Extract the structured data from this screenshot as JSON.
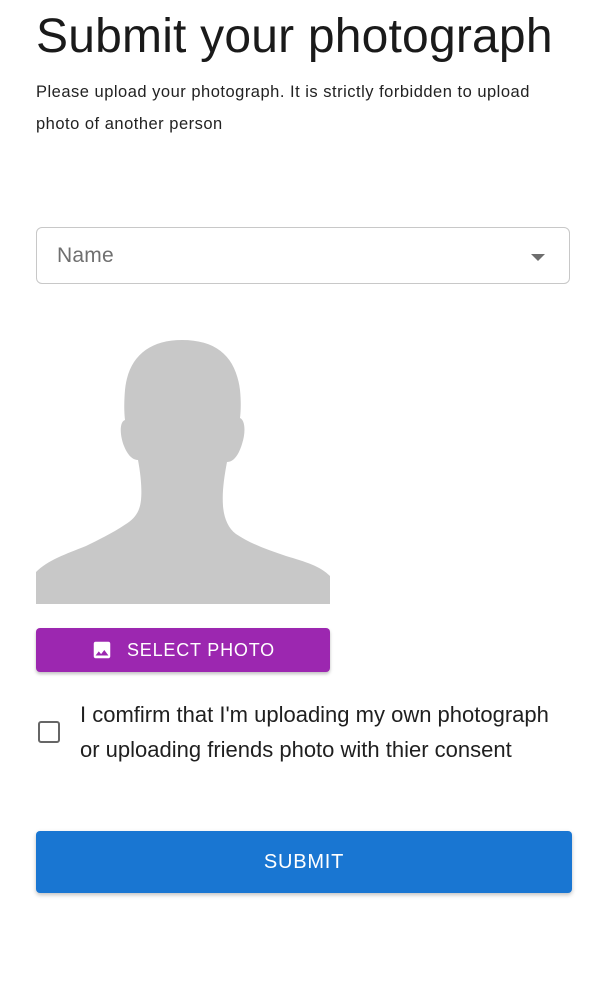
{
  "header": {
    "title": "Submit your photograph",
    "subtitle": "Please upload your photograph. It is strictly forbidden to upload photo of another person"
  },
  "form": {
    "name_select": {
      "label": "Name",
      "arrow_icon": "arrow-drop-down-icon"
    },
    "avatar_icon": "person-silhouette-icon",
    "select_photo_button": {
      "label": "SELECT PHOTO",
      "icon": "image-icon",
      "color": "#9c27b0"
    },
    "consent": {
      "checked": false,
      "label": "I comfirm that I'm uploading my own photograph or uploading friends photo with thier consent"
    },
    "submit_button": {
      "label": "SUBMIT",
      "color": "#1976d2"
    }
  }
}
